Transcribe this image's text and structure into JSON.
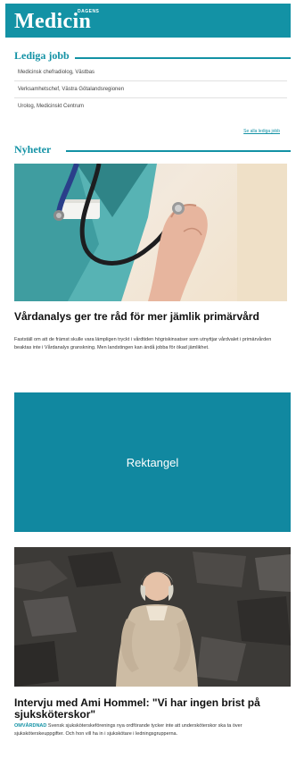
{
  "brand": {
    "name": "Medicin",
    "prefix": "DAGENS",
    "color": "#1392a5"
  },
  "jobs_section": {
    "title": "Lediga jobb",
    "items": [
      "Medicinsk chefradiolog, Västbas",
      "Verksamhetschef, Västra Götalandsregionen",
      "Urolog, Medicinskt Centrum"
    ],
    "more_link": "Se alla lediga jobb"
  },
  "news_section": {
    "title": "Nyheter"
  },
  "articles": [
    {
      "title": "Vårdanalys ger tre råd för mer jämlik primärvård",
      "body": "Fastställ om att de främst skulle vara lämpligen tryckt i vårdtiden högriskinsatser som utnyttjar vårdvalet i primärvården beaktas inte i Vårdanalys granskning. Men landstingen kan ändå jobba för ökad jämlikhet."
    },
    {
      "title": "Intervju med Ami Hommel: \"Vi har ingen brist på sjuksköterskor\"",
      "kicker": "OMVÅRDNAD",
      "body": "Svensk sjuksköterskeförenings nya ordförande tycker inte att undersköterskor ska ta över sjuksköterskeuppgifter. Och hon vill ha in i sjukskötare i ledningsgrupperna."
    }
  ],
  "ad": {
    "label": "Rektangel"
  }
}
